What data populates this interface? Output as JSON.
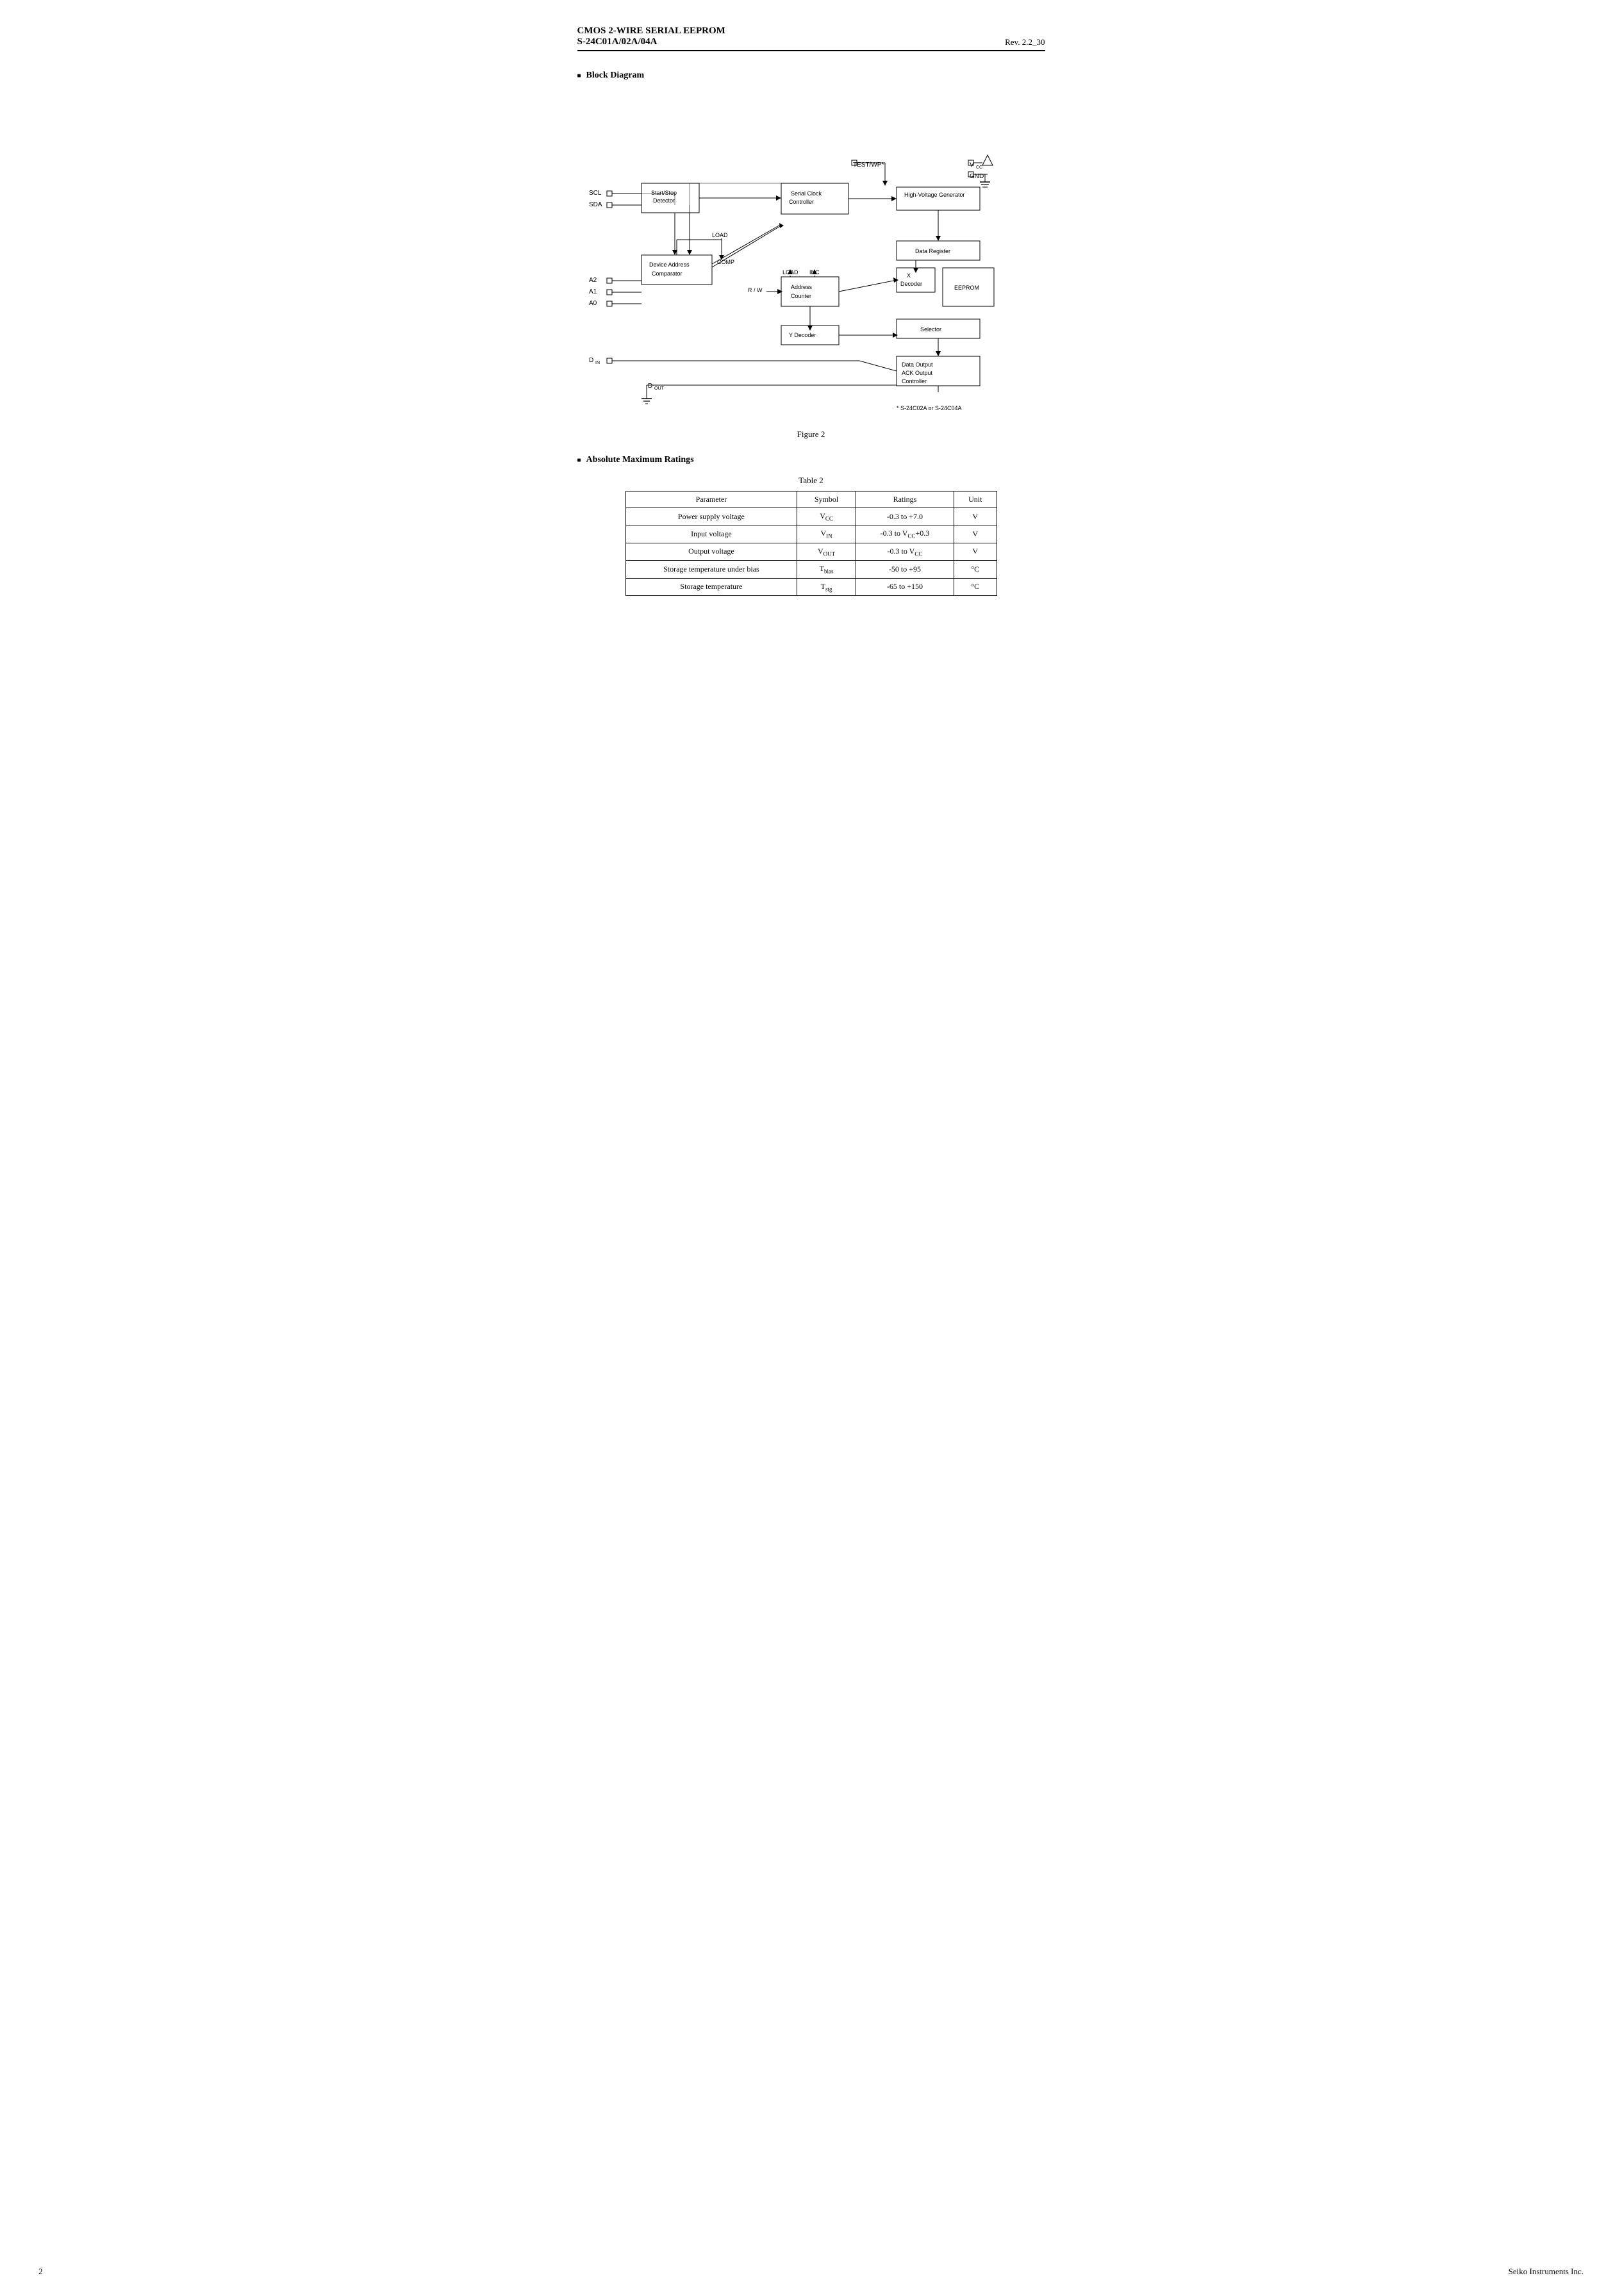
{
  "header": {
    "line1": "CMOS 2-WIRE SERIAL  EEPROM",
    "line2": "S-24C01A/02A/04A",
    "rev": "Rev. 2.2_30"
  },
  "sections": {
    "block_diagram": {
      "heading": "Block Diagram",
      "figure_label": "Figure 2",
      "note": "* S-24C02A or S-24C04A"
    },
    "ratings": {
      "heading": "Absolute Maximum Ratings",
      "table_label": "Table  2",
      "columns": [
        "Parameter",
        "Symbol",
        "Ratings",
        "Unit"
      ],
      "rows": [
        [
          "Power supply voltage",
          "V_CC",
          "-0.3 to +7.0",
          "V"
        ],
        [
          "Input voltage",
          "V_IN",
          "-0.3 to V_CC+0.3",
          "V"
        ],
        [
          "Output voltage",
          "V_OUT",
          "-0.3 to V_CC",
          "V"
        ],
        [
          "Storage temperature under bias",
          "T_bias",
          "-50 to +95",
          "°C"
        ],
        [
          "Storage temperature",
          "T_stg",
          "-65 to +150",
          "°C"
        ]
      ]
    }
  },
  "footer": {
    "page": "2",
    "company": "Seiko Instruments Inc."
  }
}
